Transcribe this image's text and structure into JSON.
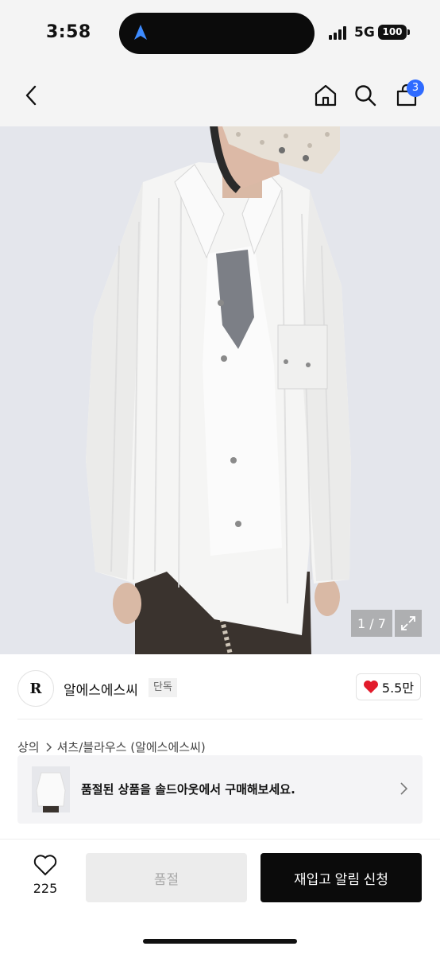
{
  "status_bar": {
    "time": "3:58",
    "network": "5G",
    "battery": "100"
  },
  "nav": {
    "cart_count": "3"
  },
  "gallery": {
    "pager": "1 / 7"
  },
  "brand": {
    "logo_text": "R",
    "name": "알에스에스씨",
    "tag": "단독",
    "likes": "5.5만"
  },
  "breadcrumb": {
    "category": "상의",
    "subcategory": "셔츠/블라우스 (알에스에스씨)"
  },
  "banner": {
    "text": "품절된 상품을 솔드아웃에서 구매해보세요."
  },
  "bottom_bar": {
    "wish_count": "225",
    "soldout_label": "품절",
    "restock_label": "재입고 알림 신청"
  },
  "colors": {
    "accent": "#2f6bff",
    "heart": "#e21b2b",
    "primary_button": "#0b0b0b"
  },
  "icons": [
    "back-icon",
    "home-icon",
    "search-icon",
    "cart-icon",
    "expand-icon",
    "heart-icon",
    "chevron-right-icon"
  ]
}
